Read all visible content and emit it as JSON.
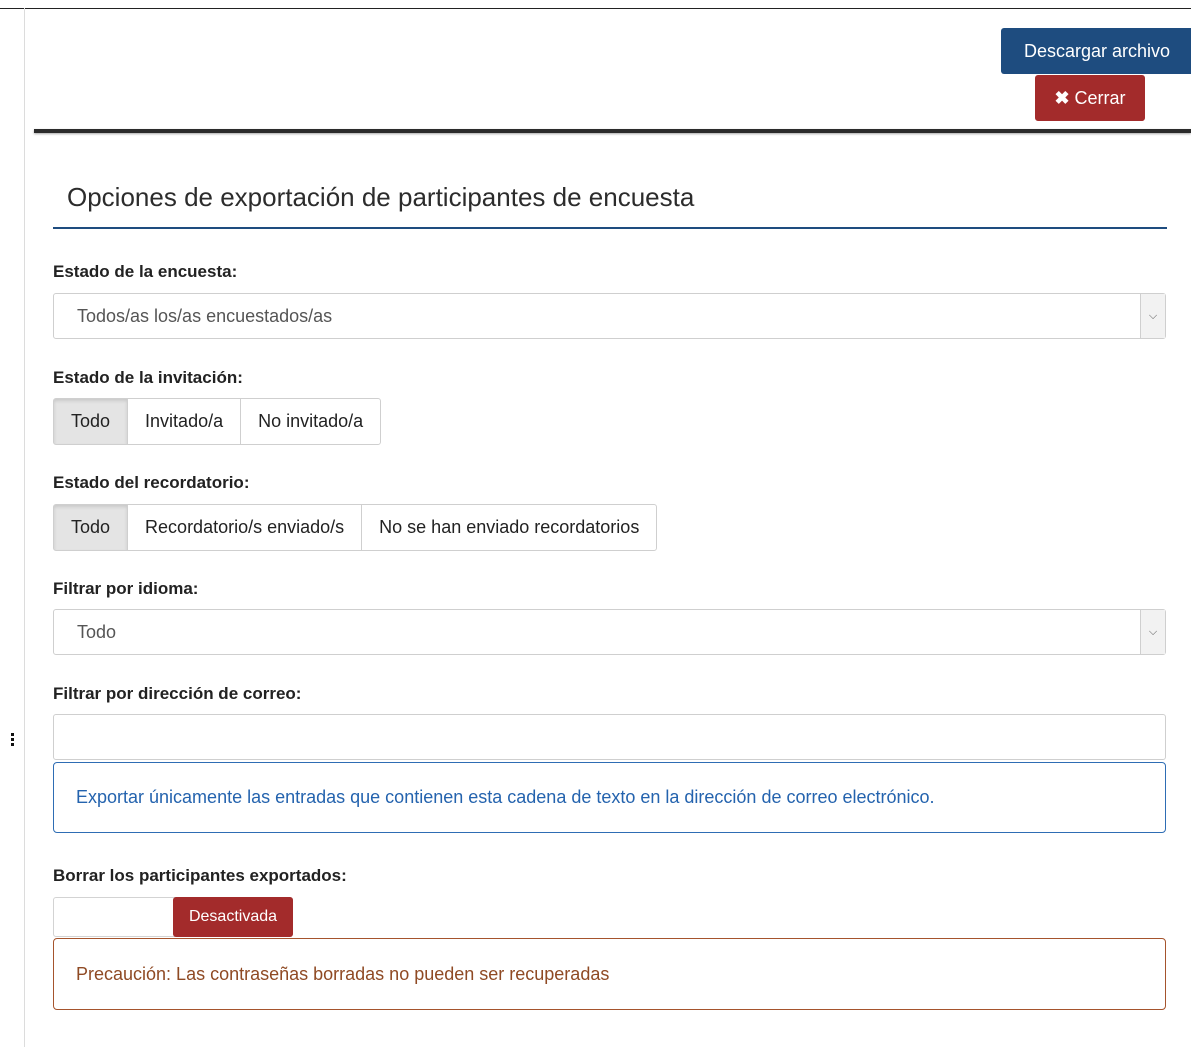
{
  "toolbar": {
    "download_label": "Descargar archivo",
    "close_icon": "✖",
    "close_label": "Cerrar"
  },
  "panel": {
    "title": "Opciones de exportación de participantes de encuesta"
  },
  "survey_status": {
    "label": "Estado de la encuesta:",
    "selected": "Todos/as los/as encuestados/as"
  },
  "invitation_status": {
    "label": "Estado de la invitación:",
    "options": [
      "Todo",
      "Invitado/a",
      "No invitado/a"
    ],
    "active": "Todo"
  },
  "reminder_status": {
    "label": "Estado del recordatorio:",
    "options": [
      "Todo",
      "Recordatorio/s enviado/s",
      "No se han enviado recordatorios"
    ],
    "active": "Todo"
  },
  "language_filter": {
    "label": "Filtrar por idioma:",
    "selected": "Todo"
  },
  "email_filter": {
    "label": "Filtrar por dirección de correo:",
    "value": "",
    "help": "Exportar únicamente las entradas que contienen esta cadena de texto en la dirección de correo electrónico."
  },
  "delete_exported": {
    "label": "Borrar los participantes exportados:",
    "toggle_label": "Desactivada",
    "warning": "Precaución: Las contraseñas borradas no pueden ser recuperadas"
  },
  "colors": {
    "primary": "#1e4c7f",
    "danger": "#a32b2b",
    "info_text": "#2463ae",
    "warning_text": "#8f4a24"
  }
}
